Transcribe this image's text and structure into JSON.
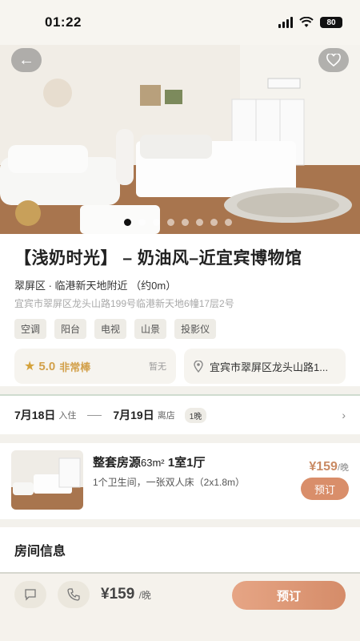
{
  "status": {
    "time": "01:22",
    "battery": "80"
  },
  "hero": {
    "image_label": "bedroom-photo",
    "dot_count": 8,
    "active_dot": 0
  },
  "listing": {
    "title": "【浅奶时光】 – 奶油风–近宜宾博物馆",
    "area": "翠屏区 · 临港新天地附近 （约0m）",
    "address": "宜宾市翠屏区龙头山路199号临港新天地6幢17层2号",
    "tags": [
      "空调",
      "阳台",
      "电视",
      "山景",
      "投影仪"
    ],
    "rating": {
      "score": "5.0",
      "label": "非常棒",
      "reviews": "暂无"
    },
    "location_short": "宜宾市翠屏区龙头山路1..."
  },
  "dates": {
    "checkin": "7月18日",
    "checkin_label": "入住",
    "checkout": "7月19日",
    "checkout_label": "离店",
    "nights": "1晚"
  },
  "room": {
    "name": "整套房源",
    "size": "63m²",
    "layout": "1室1厅",
    "detail": "1个卫生间，一张双人床（2x1.8m）",
    "price": "¥159",
    "price_unit": "/晚",
    "book_label": "预订"
  },
  "room_info": {
    "title": "房间信息"
  },
  "bottom": {
    "price": "¥159",
    "price_unit": "/晚",
    "book_label": "预订",
    "chat_icon": "chat-icon",
    "phone_icon": "phone-icon"
  }
}
